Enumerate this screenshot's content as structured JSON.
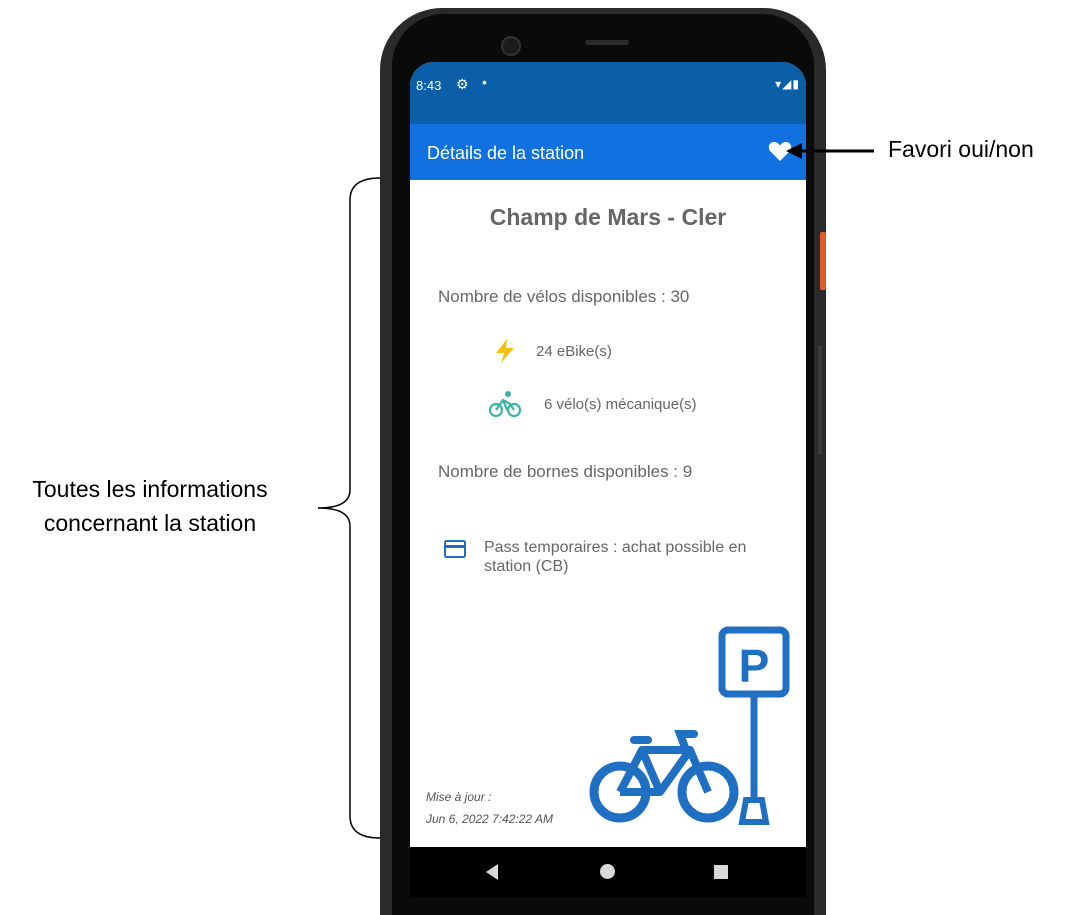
{
  "annotations": {
    "left_line1": "Toutes les informations",
    "left_line2": "concernant la station",
    "right": "Favori oui/non"
  },
  "status_bar": {
    "time": "8:43",
    "settings_icon": "gear-icon",
    "dot": "•",
    "right_icons": "▾◢▮"
  },
  "app_bar": {
    "title": "Détails de la station",
    "favorite_icon": "heart-icon"
  },
  "station": {
    "name": "Champ de Mars - Cler",
    "bikes_available": "Nombre de vélos disponibles : 30",
    "ebikes": "24 eBike(s)",
    "mechanical": "6 vélo(s) mécanique(s)",
    "docks_available": "Nombre de bornes disponibles : 9",
    "pass": "Pass temporaires : achat possible en station (CB)",
    "update_label": "Mise à jour :",
    "update_date": "Jun 6, 2022 7:42:22 AM",
    "parking_sign_letter": "P"
  },
  "colors": {
    "status_bar": "#0b5ea8",
    "app_bar": "#1271e0",
    "bolt": "#f4c20d",
    "bike_teal": "#3bb3a8",
    "illustration_blue": "#1f6fc2",
    "text_grey": "#666666"
  }
}
